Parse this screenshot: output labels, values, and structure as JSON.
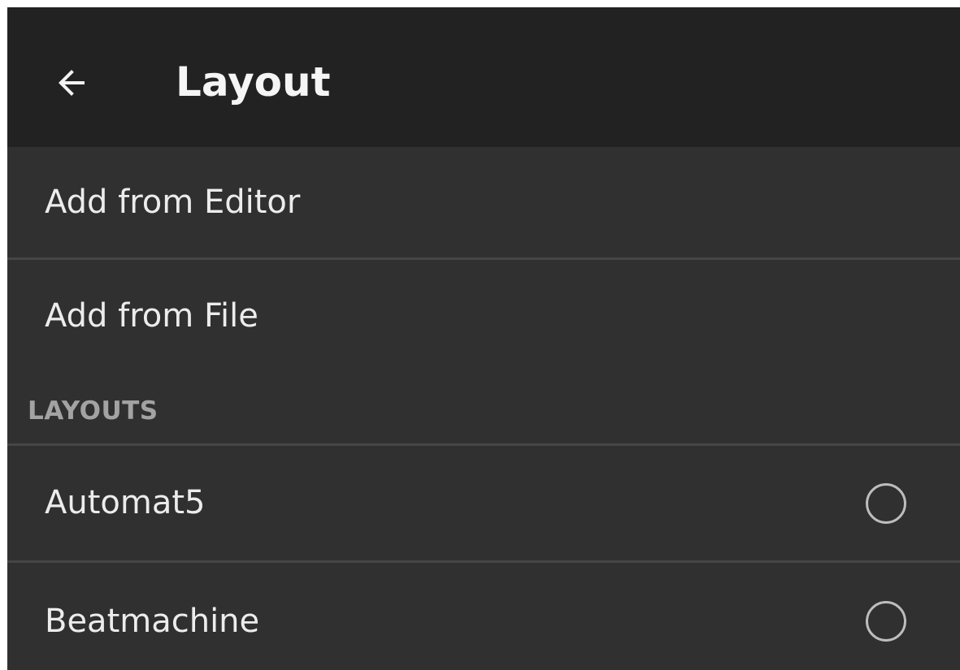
{
  "appbar": {
    "title": "Layout",
    "back_icon": "arrow-left-icon"
  },
  "actions": [
    {
      "label": "Add from Editor"
    },
    {
      "label": "Add from File"
    }
  ],
  "layouts_section": {
    "header": "LAYOUTS",
    "items": [
      {
        "label": "Automat5",
        "selected": false,
        "icon": "radio-unchecked-icon"
      },
      {
        "label": "Beatmachine",
        "selected": false,
        "icon": "radio-unchecked-icon"
      }
    ]
  },
  "colors": {
    "appbar_background": "#222222",
    "list_background": "#303030",
    "divider": "#464646",
    "primary_text": "#ececec",
    "section_header_text": "#a3a3a3",
    "radio_outline": "#bdbdbd"
  }
}
